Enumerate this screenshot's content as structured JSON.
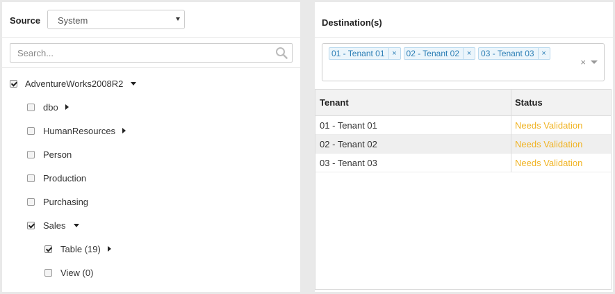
{
  "source": {
    "label": "Source",
    "selected": "System"
  },
  "search": {
    "placeholder": "Search..."
  },
  "tree": {
    "root": {
      "label": "AdventureWorks2008R2",
      "checked": true,
      "expanded": true
    },
    "schemas": [
      {
        "label": "dbo",
        "checked": false,
        "caret": "right"
      },
      {
        "label": "HumanResources",
        "checked": false,
        "caret": "right"
      },
      {
        "label": "Person",
        "checked": false,
        "caret": "none"
      },
      {
        "label": "Production",
        "checked": false,
        "caret": "none"
      },
      {
        "label": "Purchasing",
        "checked": false,
        "caret": "none"
      },
      {
        "label": "Sales",
        "checked": true,
        "caret": "down"
      }
    ],
    "sales_children": [
      {
        "label": "Table (19)",
        "checked": true,
        "caret": "right"
      },
      {
        "label": "View (0)",
        "checked": false,
        "caret": "none"
      }
    ]
  },
  "destinations": {
    "title": "Destination(s)",
    "tags": [
      {
        "label": "01 - Tenant 01",
        "remove": "×"
      },
      {
        "label": "02 - Tenant 02",
        "remove": "×"
      },
      {
        "label": "03 - Tenant 03",
        "remove": "×"
      }
    ],
    "clear": "×"
  },
  "table": {
    "columns": [
      "Tenant",
      "Status"
    ],
    "rows": [
      {
        "tenant": "01 - Tenant 01",
        "status": "Needs Validation"
      },
      {
        "tenant": "02 - Tenant 02",
        "status": "Needs Validation"
      },
      {
        "tenant": "03 - Tenant 03",
        "status": "Needs Validation"
      }
    ]
  },
  "colors": {
    "status_warning": "#f0b323",
    "tag_text": "#2a7db5",
    "tag_bg": "#ebf5fb"
  }
}
